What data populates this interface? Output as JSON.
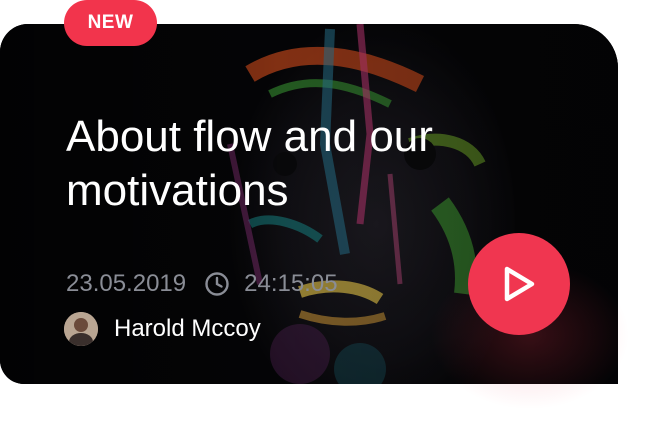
{
  "badge": {
    "label": "NEW"
  },
  "card": {
    "title": "About flow and our motivations",
    "date": "23.05.2019",
    "time_icon": "clock-icon",
    "duration": "24:15:05",
    "author": {
      "name": "Harold Mccoy"
    }
  },
  "play": {
    "icon": "play-icon"
  },
  "colors": {
    "accent": "#f03650",
    "title": "#ffffff",
    "meta": "#8a8d96",
    "card_bg": "#06060a"
  }
}
